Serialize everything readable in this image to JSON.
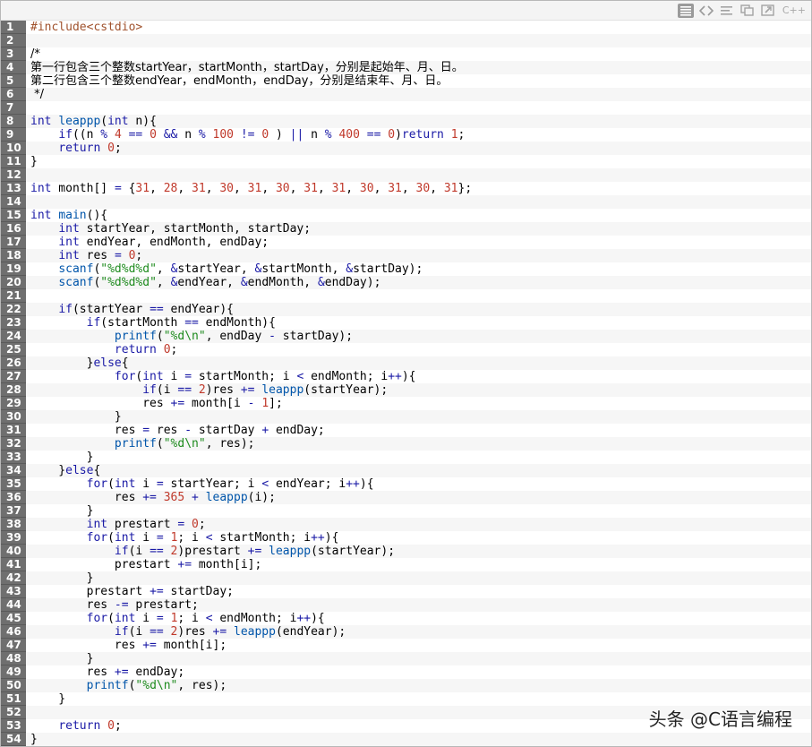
{
  "toolbar": {
    "language": "C++",
    "icons": [
      "view-plain-icon",
      "view-source-icon",
      "copy-icon",
      "print-icon",
      "popup-icon"
    ]
  },
  "watermark": "头条 @C语言编程",
  "code_lines": [
    {
      "n": "1",
      "t": [
        [
          "pre",
          "#include<cstdio>"
        ]
      ]
    },
    {
      "n": "2",
      "t": []
    },
    {
      "n": "3",
      "t": [
        [
          "cmt",
          "/*"
        ]
      ]
    },
    {
      "n": "4",
      "t": [
        [
          "cmt",
          "第一行包含三个整数startYear，startMonth，startDay，分别是起始年、月、日。"
        ]
      ]
    },
    {
      "n": "5",
      "t": [
        [
          "cmt",
          "第二行包含三个整数endYear，endMonth，endDay，分别是结束年、月、日。"
        ]
      ]
    },
    {
      "n": "6",
      "t": [
        [
          "cmt",
          " */"
        ]
      ]
    },
    {
      "n": "7",
      "t": []
    },
    {
      "n": "8",
      "t": [
        [
          "kw",
          "int"
        ],
        [
          "",
          " "
        ],
        [
          "fn",
          "leappp"
        ],
        [
          "",
          "("
        ],
        [
          "kw",
          "int"
        ],
        [
          "",
          " n){"
        ]
      ]
    },
    {
      "n": "9",
      "t": [
        [
          "",
          "    "
        ],
        [
          "kw",
          "if"
        ],
        [
          "",
          "((n "
        ],
        [
          "kw",
          "%"
        ],
        [
          "",
          " "
        ],
        [
          "num",
          "4"
        ],
        [
          "",
          " "
        ],
        [
          "kw",
          "=="
        ],
        [
          "",
          " "
        ],
        [
          "num",
          "0"
        ],
        [
          "",
          " "
        ],
        [
          "kw",
          "&&"
        ],
        [
          "",
          " n "
        ],
        [
          "kw",
          "%"
        ],
        [
          "",
          " "
        ],
        [
          "num",
          "100"
        ],
        [
          "",
          " "
        ],
        [
          "kw",
          "!="
        ],
        [
          "",
          " "
        ],
        [
          "num",
          "0"
        ],
        [
          "",
          " ) "
        ],
        [
          "kw",
          "||"
        ],
        [
          "",
          " n "
        ],
        [
          "kw",
          "%"
        ],
        [
          "",
          " "
        ],
        [
          "num",
          "400"
        ],
        [
          "",
          " "
        ],
        [
          "kw",
          "=="
        ],
        [
          "",
          " "
        ],
        [
          "num",
          "0"
        ],
        [
          "",
          ")"
        ],
        [
          "kw",
          "return"
        ],
        [
          "",
          " "
        ],
        [
          "num",
          "1"
        ],
        [
          "",
          ";"
        ]
      ]
    },
    {
      "n": "10",
      "t": [
        [
          "",
          "    "
        ],
        [
          "kw",
          "return"
        ],
        [
          "",
          " "
        ],
        [
          "num",
          "0"
        ],
        [
          "",
          ";"
        ]
      ]
    },
    {
      "n": "11",
      "t": [
        [
          "",
          "}"
        ]
      ]
    },
    {
      "n": "12",
      "t": []
    },
    {
      "n": "13",
      "t": [
        [
          "kw",
          "int"
        ],
        [
          "",
          " month[] "
        ],
        [
          "kw",
          "="
        ],
        [
          "",
          " {"
        ],
        [
          "num",
          "31"
        ],
        [
          "",
          ", "
        ],
        [
          "num",
          "28"
        ],
        [
          "",
          ", "
        ],
        [
          "num",
          "31"
        ],
        [
          "",
          ", "
        ],
        [
          "num",
          "30"
        ],
        [
          "",
          ", "
        ],
        [
          "num",
          "31"
        ],
        [
          "",
          ", "
        ],
        [
          "num",
          "30"
        ],
        [
          "",
          ", "
        ],
        [
          "num",
          "31"
        ],
        [
          "",
          ", "
        ],
        [
          "num",
          "31"
        ],
        [
          "",
          ", "
        ],
        [
          "num",
          "30"
        ],
        [
          "",
          ", "
        ],
        [
          "num",
          "31"
        ],
        [
          "",
          ", "
        ],
        [
          "num",
          "30"
        ],
        [
          "",
          ", "
        ],
        [
          "num",
          "31"
        ],
        [
          "",
          "};"
        ]
      ]
    },
    {
      "n": "14",
      "t": []
    },
    {
      "n": "15",
      "t": [
        [
          "kw",
          "int"
        ],
        [
          "",
          " "
        ],
        [
          "fn",
          "main"
        ],
        [
          "",
          "(){"
        ]
      ]
    },
    {
      "n": "16",
      "t": [
        [
          "",
          "    "
        ],
        [
          "kw",
          "int"
        ],
        [
          "",
          " startYear, startMonth, startDay;"
        ]
      ]
    },
    {
      "n": "17",
      "t": [
        [
          "",
          "    "
        ],
        [
          "kw",
          "int"
        ],
        [
          "",
          " endYear, endMonth, endDay;"
        ]
      ]
    },
    {
      "n": "18",
      "t": [
        [
          "",
          "    "
        ],
        [
          "kw",
          "int"
        ],
        [
          "",
          " res "
        ],
        [
          "kw",
          "="
        ],
        [
          "",
          " "
        ],
        [
          "num",
          "0"
        ],
        [
          "",
          ";"
        ]
      ]
    },
    {
      "n": "19",
      "t": [
        [
          "",
          "    "
        ],
        [
          "fn",
          "scanf"
        ],
        [
          "",
          "("
        ],
        [
          "str",
          "\"%d%d%d\""
        ],
        [
          "",
          ", "
        ],
        [
          "kw",
          "&"
        ],
        [
          "",
          "startYear, "
        ],
        [
          "kw",
          "&"
        ],
        [
          "",
          "startMonth, "
        ],
        [
          "kw",
          "&"
        ],
        [
          "",
          "startDay);"
        ]
      ]
    },
    {
      "n": "20",
      "t": [
        [
          "",
          "    "
        ],
        [
          "fn",
          "scanf"
        ],
        [
          "",
          "("
        ],
        [
          "str",
          "\"%d%d%d\""
        ],
        [
          "",
          ", "
        ],
        [
          "kw",
          "&"
        ],
        [
          "",
          "endYear, "
        ],
        [
          "kw",
          "&"
        ],
        [
          "",
          "endMonth, "
        ],
        [
          "kw",
          "&"
        ],
        [
          "",
          "endDay);"
        ]
      ]
    },
    {
      "n": "21",
      "t": []
    },
    {
      "n": "22",
      "t": [
        [
          "",
          "    "
        ],
        [
          "kw",
          "if"
        ],
        [
          "",
          "(startYear "
        ],
        [
          "kw",
          "=="
        ],
        [
          "",
          " endYear){"
        ]
      ]
    },
    {
      "n": "23",
      "t": [
        [
          "",
          "        "
        ],
        [
          "kw",
          "if"
        ],
        [
          "",
          "(startMonth "
        ],
        [
          "kw",
          "=="
        ],
        [
          "",
          " endMonth){"
        ]
      ]
    },
    {
      "n": "24",
      "t": [
        [
          "",
          "            "
        ],
        [
          "fn",
          "printf"
        ],
        [
          "",
          "("
        ],
        [
          "str",
          "\"%d\\n\""
        ],
        [
          "",
          ", endDay "
        ],
        [
          "kw",
          "-"
        ],
        [
          "",
          " startDay);"
        ]
      ]
    },
    {
      "n": "25",
      "t": [
        [
          "",
          "            "
        ],
        [
          "kw",
          "return"
        ],
        [
          "",
          " "
        ],
        [
          "num",
          "0"
        ],
        [
          "",
          ";"
        ]
      ]
    },
    {
      "n": "26",
      "t": [
        [
          "",
          "        }"
        ],
        [
          "kw",
          "else"
        ],
        [
          "",
          "{"
        ]
      ]
    },
    {
      "n": "27",
      "t": [
        [
          "",
          "            "
        ],
        [
          "kw",
          "for"
        ],
        [
          "",
          "("
        ],
        [
          "kw",
          "int"
        ],
        [
          "",
          " i "
        ],
        [
          "kw",
          "="
        ],
        [
          "",
          " startMonth; i "
        ],
        [
          "kw",
          "<"
        ],
        [
          "",
          " endMonth; i"
        ],
        [
          "kw",
          "++"
        ],
        [
          "",
          "){"
        ]
      ]
    },
    {
      "n": "28",
      "t": [
        [
          "",
          "                "
        ],
        [
          "kw",
          "if"
        ],
        [
          "",
          "(i "
        ],
        [
          "kw",
          "=="
        ],
        [
          "",
          " "
        ],
        [
          "num",
          "2"
        ],
        [
          "",
          ")res "
        ],
        [
          "kw",
          "+="
        ],
        [
          "",
          " "
        ],
        [
          "fn",
          "leappp"
        ],
        [
          "",
          "(startYear);"
        ]
      ]
    },
    {
      "n": "29",
      "t": [
        [
          "",
          "                res "
        ],
        [
          "kw",
          "+="
        ],
        [
          "",
          " month[i "
        ],
        [
          "kw",
          "-"
        ],
        [
          "",
          " "
        ],
        [
          "num",
          "1"
        ],
        [
          "",
          "];"
        ]
      ]
    },
    {
      "n": "30",
      "t": [
        [
          "",
          "            }"
        ]
      ]
    },
    {
      "n": "31",
      "t": [
        [
          "",
          "            res "
        ],
        [
          "kw",
          "="
        ],
        [
          "",
          " res "
        ],
        [
          "kw",
          "-"
        ],
        [
          "",
          " startDay "
        ],
        [
          "kw",
          "+"
        ],
        [
          "",
          " endDay;"
        ]
      ]
    },
    {
      "n": "32",
      "t": [
        [
          "",
          "            "
        ],
        [
          "fn",
          "printf"
        ],
        [
          "",
          "("
        ],
        [
          "str",
          "\"%d\\n\""
        ],
        [
          "",
          ", res);"
        ]
      ]
    },
    {
      "n": "33",
      "t": [
        [
          "",
          "        }"
        ]
      ]
    },
    {
      "n": "34",
      "t": [
        [
          "",
          "    }"
        ],
        [
          "kw",
          "else"
        ],
        [
          "",
          "{"
        ]
      ]
    },
    {
      "n": "35",
      "t": [
        [
          "",
          "        "
        ],
        [
          "kw",
          "for"
        ],
        [
          "",
          "("
        ],
        [
          "kw",
          "int"
        ],
        [
          "",
          " i "
        ],
        [
          "kw",
          "="
        ],
        [
          "",
          " startYear; i "
        ],
        [
          "kw",
          "<"
        ],
        [
          "",
          " endYear; i"
        ],
        [
          "kw",
          "++"
        ],
        [
          "",
          "){"
        ]
      ]
    },
    {
      "n": "36",
      "t": [
        [
          "",
          "            res "
        ],
        [
          "kw",
          "+="
        ],
        [
          "",
          " "
        ],
        [
          "num",
          "365"
        ],
        [
          "",
          " "
        ],
        [
          "kw",
          "+"
        ],
        [
          "",
          " "
        ],
        [
          "fn",
          "leappp"
        ],
        [
          "",
          "(i);"
        ]
      ]
    },
    {
      "n": "37",
      "t": [
        [
          "",
          "        }"
        ]
      ]
    },
    {
      "n": "38",
      "t": [
        [
          "",
          "        "
        ],
        [
          "kw",
          "int"
        ],
        [
          "",
          " prestart "
        ],
        [
          "kw",
          "="
        ],
        [
          "",
          " "
        ],
        [
          "num",
          "0"
        ],
        [
          "",
          ";"
        ]
      ]
    },
    {
      "n": "39",
      "t": [
        [
          "",
          "        "
        ],
        [
          "kw",
          "for"
        ],
        [
          "",
          "("
        ],
        [
          "kw",
          "int"
        ],
        [
          "",
          " i "
        ],
        [
          "kw",
          "="
        ],
        [
          "",
          " "
        ],
        [
          "num",
          "1"
        ],
        [
          "",
          "; i "
        ],
        [
          "kw",
          "<"
        ],
        [
          "",
          " startMonth; i"
        ],
        [
          "kw",
          "++"
        ],
        [
          "",
          "){"
        ]
      ]
    },
    {
      "n": "40",
      "t": [
        [
          "",
          "            "
        ],
        [
          "kw",
          "if"
        ],
        [
          "",
          "(i "
        ],
        [
          "kw",
          "=="
        ],
        [
          "",
          " "
        ],
        [
          "num",
          "2"
        ],
        [
          "",
          ")prestart "
        ],
        [
          "kw",
          "+="
        ],
        [
          "",
          " "
        ],
        [
          "fn",
          "leappp"
        ],
        [
          "",
          "(startYear);"
        ]
      ]
    },
    {
      "n": "41",
      "t": [
        [
          "",
          "            prestart "
        ],
        [
          "kw",
          "+="
        ],
        [
          "",
          " month[i];"
        ]
      ]
    },
    {
      "n": "42",
      "t": [
        [
          "",
          "        }"
        ]
      ]
    },
    {
      "n": "43",
      "t": [
        [
          "",
          "        prestart "
        ],
        [
          "kw",
          "+="
        ],
        [
          "",
          " startDay;"
        ]
      ]
    },
    {
      "n": "44",
      "t": [
        [
          "",
          "        res "
        ],
        [
          "kw",
          "-="
        ],
        [
          "",
          " prestart;"
        ]
      ]
    },
    {
      "n": "45",
      "t": [
        [
          "",
          "        "
        ],
        [
          "kw",
          "for"
        ],
        [
          "",
          "("
        ],
        [
          "kw",
          "int"
        ],
        [
          "",
          " i "
        ],
        [
          "kw",
          "="
        ],
        [
          "",
          " "
        ],
        [
          "num",
          "1"
        ],
        [
          "",
          "; i "
        ],
        [
          "kw",
          "<"
        ],
        [
          "",
          " endMonth; i"
        ],
        [
          "kw",
          "++"
        ],
        [
          "",
          "){"
        ]
      ]
    },
    {
      "n": "46",
      "t": [
        [
          "",
          "            "
        ],
        [
          "kw",
          "if"
        ],
        [
          "",
          "(i "
        ],
        [
          "kw",
          "=="
        ],
        [
          "",
          " "
        ],
        [
          "num",
          "2"
        ],
        [
          "",
          ")res "
        ],
        [
          "kw",
          "+="
        ],
        [
          "",
          " "
        ],
        [
          "fn",
          "leappp"
        ],
        [
          "",
          "(endYear);"
        ]
      ]
    },
    {
      "n": "47",
      "t": [
        [
          "",
          "            res "
        ],
        [
          "kw",
          "+="
        ],
        [
          "",
          " month[i];"
        ]
      ]
    },
    {
      "n": "48",
      "t": [
        [
          "",
          "        }"
        ]
      ]
    },
    {
      "n": "49",
      "t": [
        [
          "",
          "        res "
        ],
        [
          "kw",
          "+="
        ],
        [
          "",
          " endDay;"
        ]
      ]
    },
    {
      "n": "50",
      "t": [
        [
          "",
          "        "
        ],
        [
          "fn",
          "printf"
        ],
        [
          "",
          "("
        ],
        [
          "str",
          "\"%d\\n\""
        ],
        [
          "",
          ", res);"
        ]
      ]
    },
    {
      "n": "51",
      "t": [
        [
          "",
          "    }"
        ]
      ]
    },
    {
      "n": "52",
      "t": []
    },
    {
      "n": "53",
      "t": [
        [
          "",
          "    "
        ],
        [
          "kw",
          "return"
        ],
        [
          "",
          " "
        ],
        [
          "num",
          "0"
        ],
        [
          "",
          ";"
        ]
      ]
    },
    {
      "n": "54",
      "t": [
        [
          "",
          "}"
        ]
      ]
    }
  ]
}
